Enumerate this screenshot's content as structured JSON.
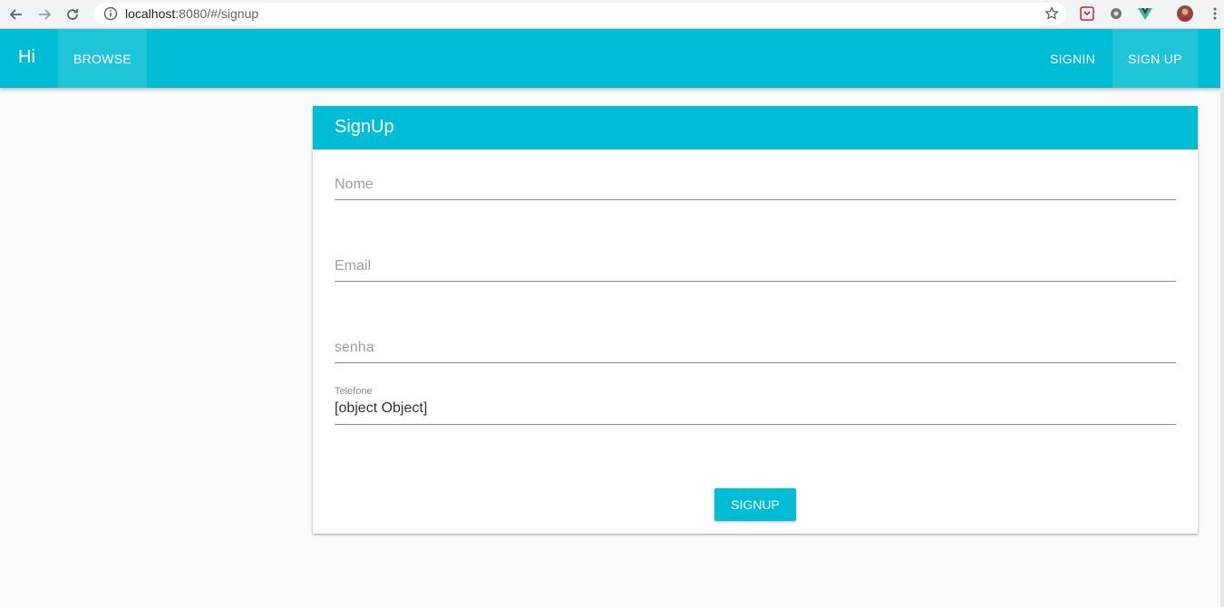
{
  "browser": {
    "url_host": "localhost",
    "url_rest": ":8080/#/signup",
    "icons": [
      "back-arrow-icon",
      "forward-arrow-icon",
      "reload-icon",
      "info-icon",
      "bookmark-star-icon",
      "extension-icons",
      "profile-avatar",
      "menu-dots-icon"
    ]
  },
  "appbar": {
    "brand": "Hi",
    "browse": "BROWSE",
    "signin": "SIGNIN",
    "signup": "SIGN UP",
    "color": "#00bcd4"
  },
  "form": {
    "title": "SignUp",
    "nome_placeholder": "Nome",
    "email_placeholder": "Email",
    "senha_placeholder": "senha",
    "telefone_label": "Telefone",
    "telefone_value": "[object Object]",
    "submit": "SIGNUP"
  }
}
